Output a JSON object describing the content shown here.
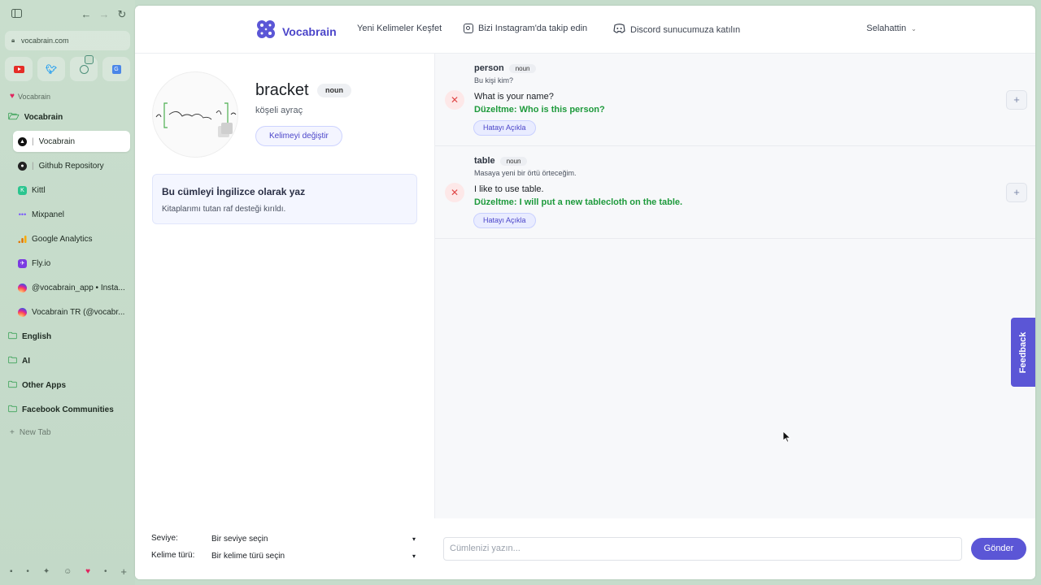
{
  "browser": {
    "url": "vocabrain.com",
    "pinned_tabs": [
      "youtube-icon",
      "twitter-icon",
      "chat-icon",
      "translate-icon"
    ],
    "section_label": "Vocabrain",
    "folders": [
      {
        "label": "Vocabrain",
        "open": true
      },
      {
        "label": "English"
      },
      {
        "label": "AI"
      },
      {
        "label": "Other Apps"
      },
      {
        "label": "Facebook Communities"
      }
    ],
    "tabs": [
      {
        "label": "Vocabrain",
        "active": true
      },
      {
        "label": "Github Repository"
      },
      {
        "label": "Kittl"
      },
      {
        "label": "Mixpanel"
      },
      {
        "label": "Google Analytics"
      },
      {
        "label": "Fly.io"
      },
      {
        "label": "@vocabrain_app • Insta..."
      },
      {
        "label": "Vocabrain TR (@vocabr..."
      }
    ],
    "new_tab": "New Tab"
  },
  "nav": {
    "brand": "Vocabrain",
    "discover": "Yeni Kelimeler Keşfet",
    "instagram": "Bizi Instagram'da takip edin",
    "discord": "Discord sunucumuza katılın",
    "user": "Selahattin"
  },
  "word": {
    "title": "bracket",
    "pos": "noun",
    "translation": "köşeli ayraç",
    "change_button": "Kelimeyi değiştir"
  },
  "task": {
    "title": "Bu cümleyi İngilizce olarak yaz",
    "text": "Kitaplarımı tutan raf desteği kırıldı."
  },
  "entries": [
    {
      "word": "person",
      "pos": "noun",
      "translation": "Bu kişi kim?",
      "sentence": "What is your name?",
      "fix": "Düzeltme: Who is this person?",
      "explain": "Hatayı Açıkla"
    },
    {
      "word": "table",
      "pos": "noun",
      "translation": "Masaya yeni bir örtü örteceğim.",
      "sentence": "I like to use table.",
      "fix": "Düzeltme: I will put a new tablecloth on the table.",
      "explain": "Hatayı Açıkla"
    }
  ],
  "feedback": "Feedback",
  "controls": {
    "level_label": "Seviye:",
    "level_value": "Bir seviye seçin",
    "type_label": "Kelime türü:",
    "type_value": "Bir kelime türü seçin",
    "input_placeholder": "Cümlenizi yazın...",
    "send": "Gönder"
  },
  "colors": {
    "accent": "#5b56d6",
    "success": "#1e9a3c",
    "danger": "#e04848"
  }
}
